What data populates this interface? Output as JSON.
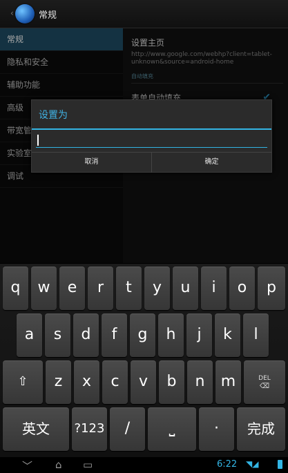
{
  "action_bar": {
    "title": "常规",
    "icon": "browser-globe-icon"
  },
  "settings": {
    "sidebar": [
      {
        "label": "常规",
        "active": true
      },
      {
        "label": "隐私和安全",
        "active": false
      },
      {
        "label": "辅助功能",
        "active": false
      },
      {
        "label": "高级",
        "active": false
      },
      {
        "label": "带宽管理",
        "active": false
      },
      {
        "label": "实验室",
        "active": false
      },
      {
        "label": "调试",
        "active": false
      }
    ],
    "homepage": {
      "title": "设置主页",
      "url": "http://www.google.com/webhp?client=tablet-unknown&source=android-home"
    },
    "section_autofill": "自动填充",
    "form_autofill": {
      "title": "表单自动填充",
      "checked": true
    }
  },
  "dialog": {
    "title": "设置为",
    "input_value": "",
    "cancel_label": "取消",
    "ok_label": "确定"
  },
  "keyboard": {
    "row1": [
      "q",
      "w",
      "e",
      "r",
      "t",
      "y",
      "u",
      "i",
      "o",
      "p"
    ],
    "row2": [
      "a",
      "s",
      "d",
      "f",
      "g",
      "h",
      "j",
      "k",
      "l"
    ],
    "row3": [
      "z",
      "x",
      "c",
      "v",
      "b",
      "n",
      "m"
    ],
    "shift_icon": "shift-icon",
    "delete_label": "DEL",
    "lang_label": "英文",
    "symbols_label": "?123",
    "slash_label": "/",
    "space_label": "⎵",
    "period_label": "·",
    "done_label": "完成"
  },
  "status_bar": {
    "time": "6:22",
    "icons": [
      "wifi-icon",
      "signal-icon",
      "battery-icon"
    ]
  },
  "nav": {
    "back_icon": "back-icon",
    "home_icon": "home-icon",
    "recents_icon": "recents-icon"
  },
  "colors": {
    "accent": "#33b5e5",
    "active_sidebar": "#1f4e66",
    "key": "#404040"
  }
}
